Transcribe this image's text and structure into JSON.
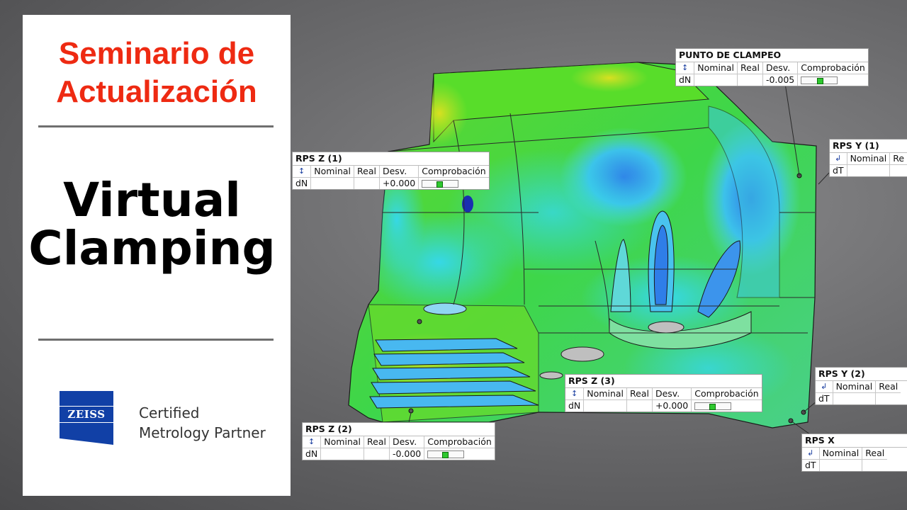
{
  "panel": {
    "seminar_line1": "Seminario de",
    "seminar_line2": "Actualización",
    "title_line1": "Virtual",
    "title_line2": "Clamping",
    "logo_text": "ZEISS",
    "partner_line1": "Certified",
    "partner_line2": "Metrology Partner"
  },
  "colors": {
    "seminar_red": "#ee2a12",
    "zeiss_blue": "#1140a6",
    "ok_green": "#2ec82e"
  },
  "callouts": [
    {
      "title": "PUNTO DE CLAMPEO",
      "headers": [
        "Nominal",
        "Real",
        "Desv.",
        "Comprobación"
      ],
      "row_label": "dN",
      "nominal": "",
      "real": "",
      "desv": "-0.005",
      "icon": "normal-arrow-icon"
    },
    {
      "title": "RPS Z (1)",
      "headers": [
        "Nominal",
        "Real",
        "Desv.",
        "Comprobación"
      ],
      "row_label": "dN",
      "nominal": "",
      "real": "",
      "desv": "+0.000",
      "icon": "normal-arrow-icon"
    },
    {
      "title": "RPS Y (1)",
      "headers": [
        "Nominal",
        "Re"
      ],
      "row_label": "dT",
      "nominal": "",
      "real": "",
      "icon": "tangent-arrow-icon"
    },
    {
      "title": "RPS Z (3)",
      "headers": [
        "Nominal",
        "Real",
        "Desv.",
        "Comprobación"
      ],
      "row_label": "dN",
      "nominal": "",
      "real": "",
      "desv": "+0.000",
      "icon": "normal-arrow-icon"
    },
    {
      "title": "RPS Y (2)",
      "headers": [
        "Nominal",
        "Real"
      ],
      "row_label": "dT",
      "nominal": "",
      "real": "",
      "icon": "tangent-arrow-icon"
    },
    {
      "title": "RPS Z (2)",
      "headers": [
        "Nominal",
        "Real",
        "Desv.",
        "Comprobación"
      ],
      "row_label": "dN",
      "nominal": "",
      "real": "",
      "desv": "-0.000",
      "icon": "normal-arrow-icon"
    },
    {
      "title": "RPS X",
      "headers": [
        "Nominal",
        "Real"
      ],
      "row_label": "dT",
      "nominal": "",
      "real": "",
      "icon": "tangent-arrow-icon"
    }
  ]
}
